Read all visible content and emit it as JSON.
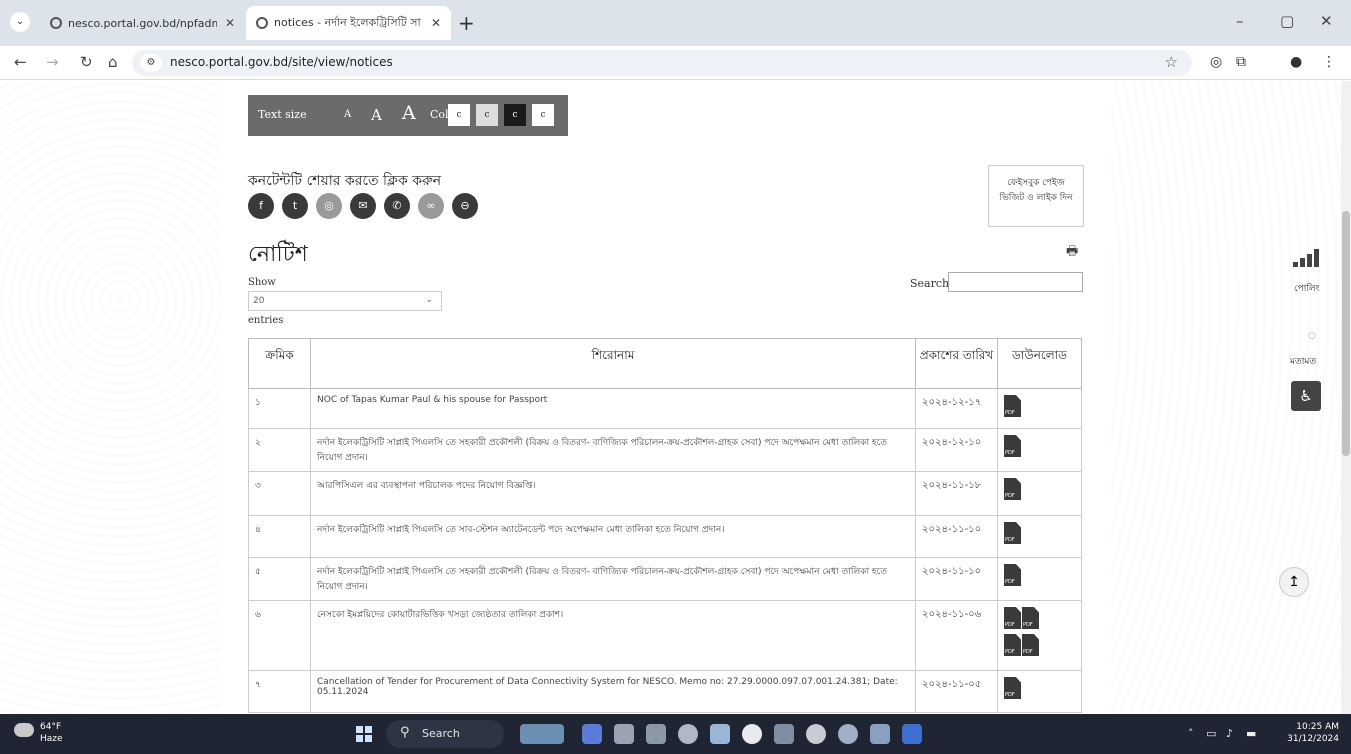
{
  "browser": {
    "tabs": [
      {
        "title": "nesco.portal.gov.bd/npfadmin/"
      },
      {
        "title": "notices - নর্দান ইলেকট্রিসিটি সা"
      }
    ],
    "new_tab": "+",
    "address": "nesco.portal.gov.bd/site/view/notices"
  },
  "toolbar": {
    "text_size_label": "Text size",
    "size_small": "A",
    "size_medium": "A",
    "size_large": "A",
    "color_label": "Color",
    "swatches": [
      {
        "label": "c",
        "bg": "#ffffff",
        "fg": "#333333"
      },
      {
        "label": "c",
        "bg": "#dddddd",
        "fg": "#333333"
      },
      {
        "label": "c",
        "bg": "#1a1a1a",
        "fg": "#ffffff"
      },
      {
        "label": "c",
        "bg": "#ffffff",
        "fg": "#333333"
      }
    ]
  },
  "share": {
    "title": "কনটেন্টটি শেয়ার করতে ক্লিক করুন",
    "buttons": [
      {
        "icon": "facebook-icon",
        "glyph": "f"
      },
      {
        "icon": "twitter-icon",
        "glyph": "t"
      },
      {
        "icon": "whatsapp-icon",
        "glyph": "◎"
      },
      {
        "icon": "email-icon",
        "glyph": "✉"
      },
      {
        "icon": "messenger-icon",
        "glyph": "✆"
      },
      {
        "icon": "link-icon",
        "glyph": "∞"
      },
      {
        "icon": "more-icon",
        "glyph": "⊖"
      }
    ]
  },
  "visit_box": {
    "text": "ফেইসবুক পেইজ ভিজিট ও লাইক দিন"
  },
  "page_title": "নোটিশ",
  "controls": {
    "show_label": "Show",
    "entries_value": "20",
    "entries_label": "entries",
    "search_label": "Search:"
  },
  "table": {
    "headers": {
      "sl": "ক্রমিক",
      "title": "শিরোনাম",
      "date": "প্রকাশের তারিখ",
      "download": "ডাউনলোড"
    },
    "pdf_label": "PDF",
    "rows": [
      {
        "sl": "১",
        "title": "NOC of Tapas Kumar Paul & his spouse for Passport",
        "date": "২০২৪-১২-১৭"
      },
      {
        "sl": "২",
        "title": "নর্দান ইলেকট্রিসিটি সাপ্লাই পিএলসি তে সহকারী প্রকৌশলী (বিক্রয় ও বিতরণ- বাণিজ্যিক পরিচালন-ক্রয়-প্রকৌশল-গ্রাহক সেবা) পদে অপেক্ষমান মেধা তালিকা হতে নিয়োগ প্রদান।",
        "date": "২০২৪-১২-১০"
      },
      {
        "sl": "৩",
        "title": "আরপিসিএল এর ব্যবস্থাপনা পরিচালক পদের নিয়োগ বিজ্ঞপ্তি।",
        "date": "২০২৪-১১-১৮"
      },
      {
        "sl": "৪",
        "title": "নর্দান ইলেকট্রিসিটি সাপ্লাই পিএলসি তে সাব-স্টেশন অ্যাটেনডেন্ট পদে অপেক্ষমান মেধা তালিকা হতে নিয়োগ প্রদান।",
        "date": "২০২৪-১১-১০"
      },
      {
        "sl": "৫",
        "title": "নর্দান ইলেকট্রিসিটি সাপ্লাই পিএলসি তে সহকারী প্রকৌশলী (বিক্রয় ও বিতরণ- বাণিজ্যিক পরিচালন-ক্রয়-প্রকৌশল-গ্রাহক সেবা) পদে অপেক্ষমান মেধা তালিকা হতে নিয়োগ প্রদান।",
        "date": "২০২৪-১১-১০"
      },
      {
        "sl": "৬",
        "title": "নেসকো ইমপ্লয়িদের কোয়ার্টারভিত্তিক খসড়া জ্যেষ্ঠতার তালিকা প্রকাশ।",
        "date": "২০২৪-১১-০৬"
      },
      {
        "sl": "৭",
        "title": "Cancellation of Tender for Procurement of Data Connectivity System for NESCO. Memo no: 27.29.0000.097.07.001.24.381; Date: 05.11.2024",
        "date": "২০২৪-১১-০৫"
      }
    ]
  },
  "side": {
    "poll_label": "পোলিং",
    "opinion_label": "মতামত"
  },
  "taskbar": {
    "temp": "64°F",
    "weather": "Haze",
    "search": "Search",
    "time": "10:25 AM",
    "date": "31/12/2024"
  }
}
